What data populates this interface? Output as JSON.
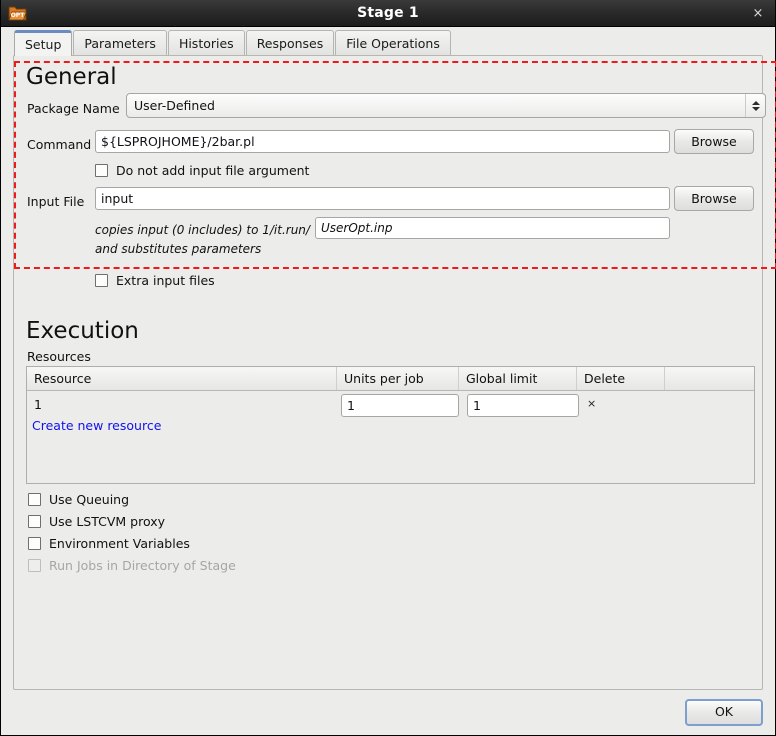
{
  "window": {
    "title": "Stage 1",
    "icon": "opt-folder-icon",
    "close_label": "×"
  },
  "tabs": [
    {
      "label": "Setup",
      "active": true
    },
    {
      "label": "Parameters",
      "active": false
    },
    {
      "label": "Histories",
      "active": false
    },
    {
      "label": "Responses",
      "active": false
    },
    {
      "label": "File Operations",
      "active": false
    }
  ],
  "general": {
    "heading": "General",
    "package_name_label": "Package Name",
    "package_name_value": "User-Defined",
    "command_label": "Command",
    "command_value": "${LSPROJHOME}/2bar.pl",
    "command_browse_label": "Browse",
    "no_input_arg_label": "Do not add input file argument",
    "no_input_arg_checked": false,
    "input_file_label": "Input File",
    "input_file_value": "input",
    "input_file_browse_label": "Browse",
    "copies_text": "copies input (0 includes) to 1/it.run/",
    "copies_target_value": "UserOpt.inp",
    "substitutes_text": "and substitutes parameters",
    "extra_input_files_label": "Extra input files",
    "extra_input_files_checked": false,
    "highlight_color": "#f01a1a"
  },
  "execution": {
    "heading": "Execution",
    "resources_label": "Resources",
    "table": {
      "columns": [
        "Resource",
        "Units per job",
        "Delete"
      ],
      "column_global_limit": "Global limit",
      "rows": [
        {
          "resource": "1",
          "units_per_job": "1",
          "global_limit": "1",
          "delete_icon": "×"
        }
      ],
      "create_link": "Create new resource"
    },
    "options": [
      {
        "label": "Use Queuing",
        "checked": false,
        "disabled": false
      },
      {
        "label": "Use LSTCVM proxy",
        "checked": false,
        "disabled": false
      },
      {
        "label": "Environment Variables",
        "checked": false,
        "disabled": false
      },
      {
        "label": "Run Jobs in Directory of Stage",
        "checked": false,
        "disabled": true
      }
    ]
  },
  "footer": {
    "ok_label": "OK"
  }
}
